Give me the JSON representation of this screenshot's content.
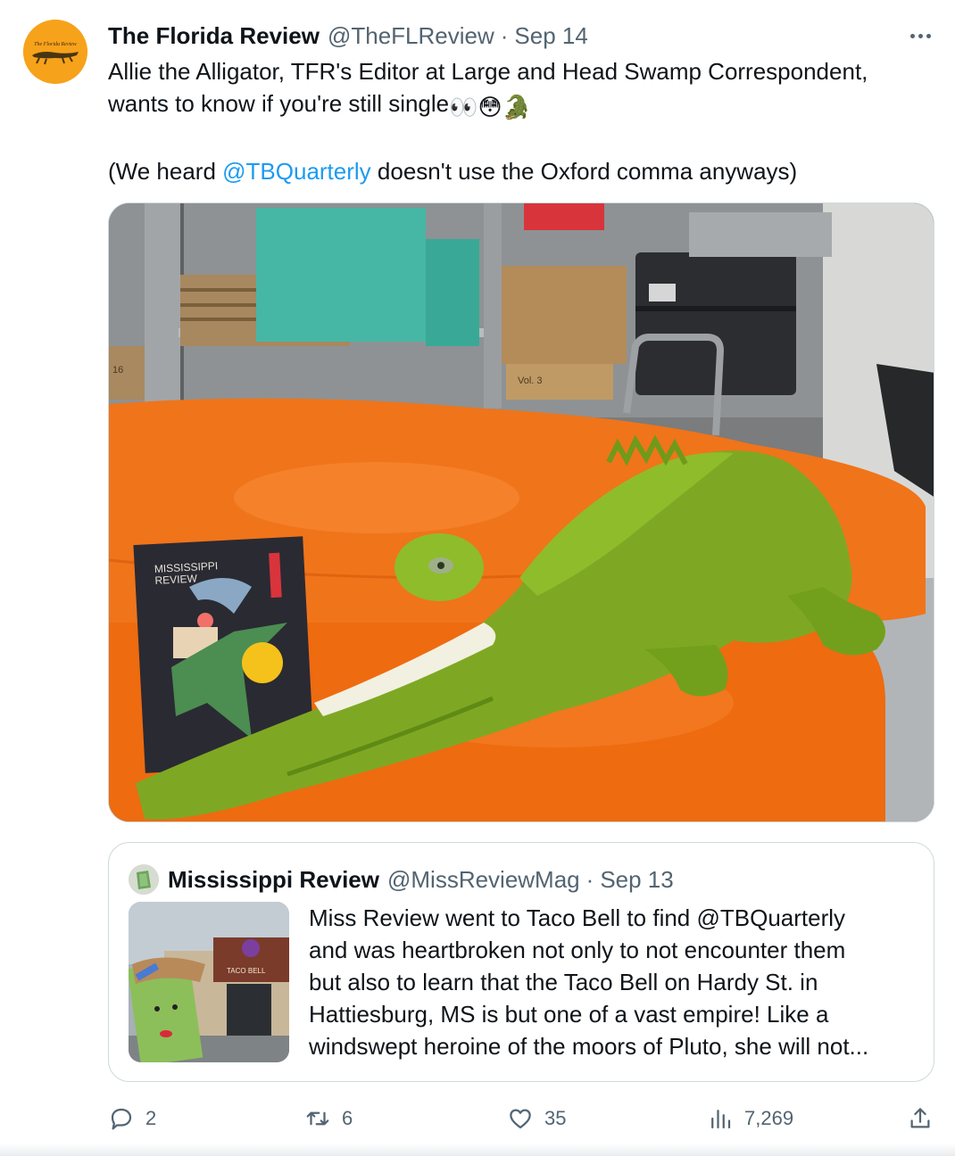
{
  "tweet": {
    "author_name": "The Florida Review",
    "handle": "@TheFLReview",
    "separator": "·",
    "date": "Sep 14",
    "avatar_text": "The Florida Review",
    "text_line1": "Allie the Alligator, TFR's Editor at Large and Head Swamp Correspondent,",
    "text_line2": "wants to know if you're still single",
    "text_line2_emoji": "👀😳🐊",
    "text_line3_before": "(We heard ",
    "text_line3_mention": "@TBQuarterly",
    "text_line3_after": " doesn't use the Oxford comma anyways)",
    "media_book_title_line1": "MISSISSIPPI",
    "media_book_title_line2": "REVIEW",
    "media_box_label": "Vol. 3",
    "media_box_label2": "16"
  },
  "quote": {
    "author_name": "Mississippi Review",
    "handle": "@MissReviewMag",
    "separator": "·",
    "date": "Sep 13",
    "thumb_sign": "TACO BELL",
    "lines": [
      "Miss Review went to Taco Bell to find @TBQuarterly",
      "and was heartbroken not only to not encounter them",
      "but also to learn that the Taco Bell on Hardy St. in",
      "Hattiesburg, MS is but one of a vast empire!  Like a",
      "windswept heroine of the moors of Pluto, she will not..."
    ]
  },
  "actions": {
    "replies": "2",
    "retweets": "6",
    "likes": "35",
    "views": "7,269"
  },
  "colors": {
    "accent": "#1d9bf0",
    "secondary_text": "#536471",
    "border": "#cfd9de",
    "avatar_bg": "#f7a21b"
  },
  "icons": [
    "more-icon",
    "reply-icon",
    "retweet-icon",
    "like-icon",
    "views-icon",
    "share-icon"
  ]
}
